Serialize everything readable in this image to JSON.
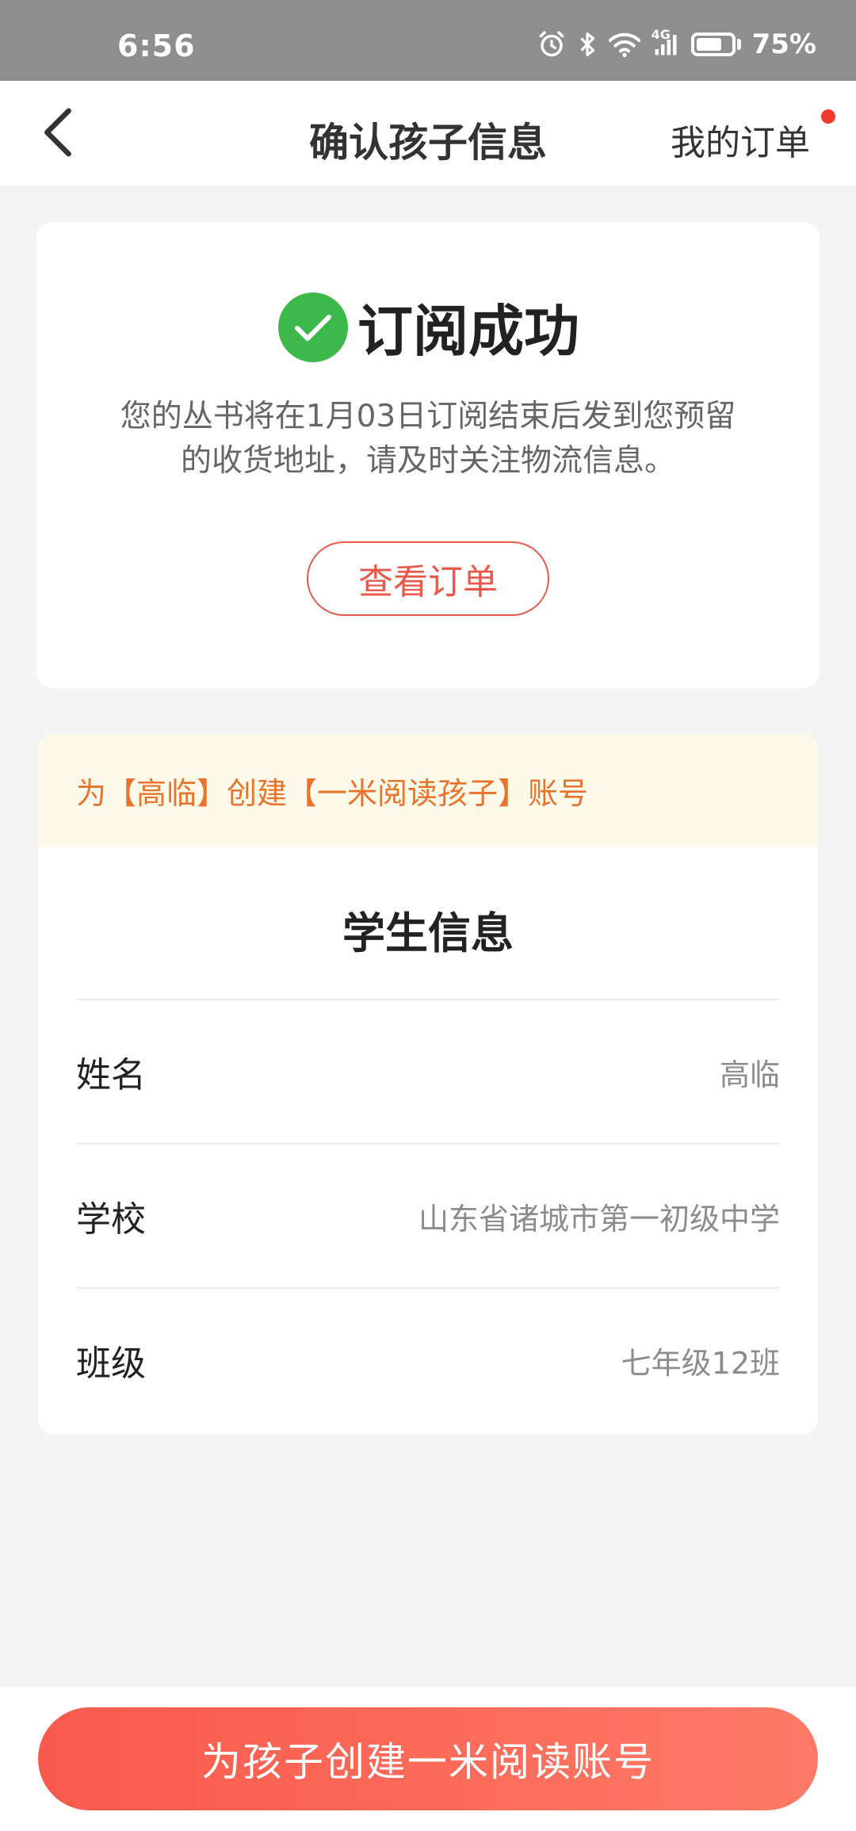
{
  "status_bar": {
    "time": "6:56",
    "network": "4G",
    "battery_text": "75%",
    "battery_level": 0.75,
    "icons": [
      "alarm-icon",
      "bluetooth-icon",
      "wifi-icon",
      "signal-icon",
      "battery-icon"
    ]
  },
  "nav": {
    "title": "确认孩子信息",
    "orders_label": "我的订单",
    "back_icon": "chevron-left-icon",
    "dot_color": "#f23a2c"
  },
  "success": {
    "title": "订阅成功",
    "description": "您的丛书将在1月03日订阅结束后发到您预留的收货地址，请及时关注物流信息。",
    "view_order_label": "查看订单",
    "check_color": "#3cb94a",
    "accent_color": "#e8584b"
  },
  "student": {
    "notice": "为【高临】创建【一米阅读孩子】账号",
    "section_title": "学生信息",
    "rows": [
      {
        "label": "姓名",
        "value": "高临"
      },
      {
        "label": "学校",
        "value": "山东省诸城市第一初级中学"
      },
      {
        "label": "班级",
        "value": "七年级12班"
      }
    ]
  },
  "bottom": {
    "create_label": "为孩子创建一米阅读账号"
  }
}
